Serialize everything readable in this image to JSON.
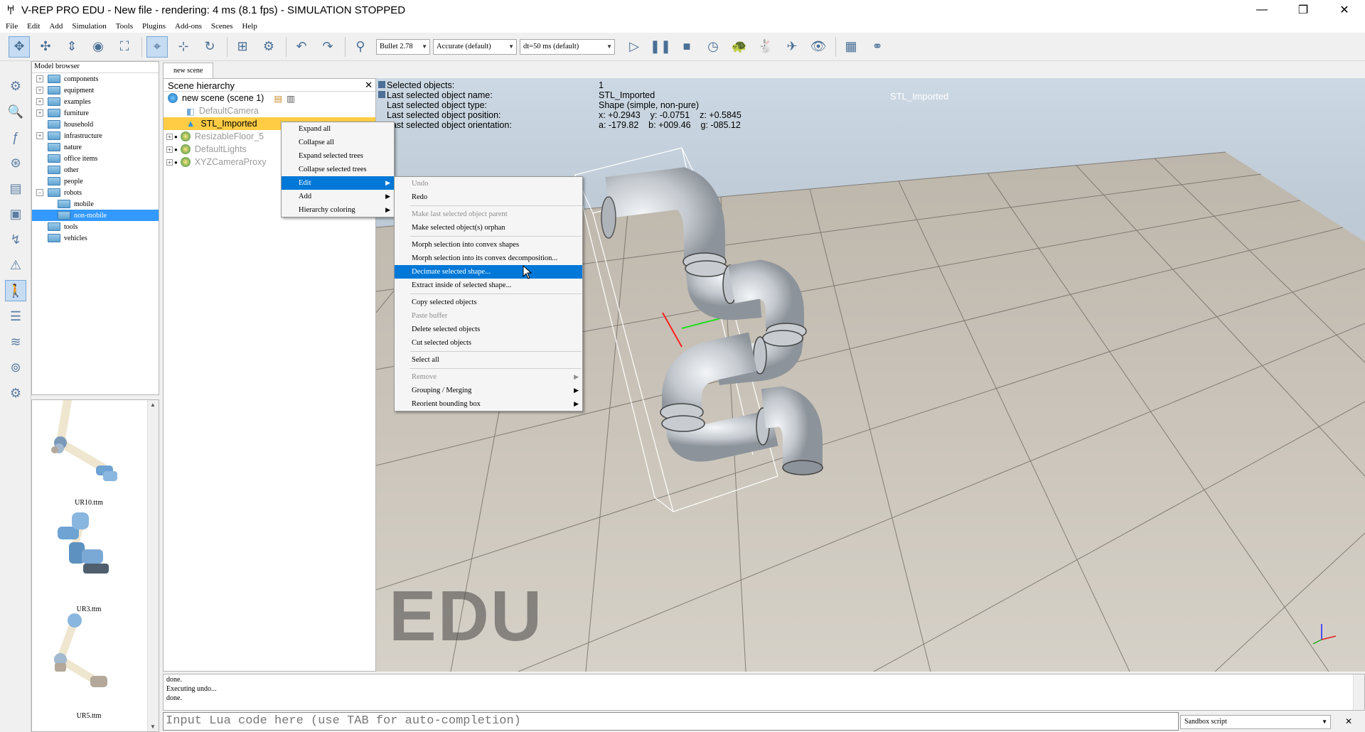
{
  "window": {
    "title": "V-REP PRO EDU - New file - rendering: 4 ms (8.1 fps) - SIMULATION STOPPED",
    "minimize": "—",
    "restore": "❐",
    "close": "✕"
  },
  "menubar": [
    "File",
    "Edit",
    "Add",
    "Simulation",
    "Tools",
    "Plugins",
    "Add-ons",
    "Scenes",
    "Help"
  ],
  "toolbar": {
    "engine": "Bullet 2.78",
    "accuracy": "Accurate (default)",
    "timestep": "dt=50 ms (default)"
  },
  "model_browser": {
    "title": "Model browser",
    "items": [
      {
        "label": "components",
        "expandable": true,
        "level": 0
      },
      {
        "label": "equipment",
        "expandable": true,
        "level": 0
      },
      {
        "label": "examples",
        "expandable": true,
        "level": 0
      },
      {
        "label": "furniture",
        "expandable": true,
        "level": 0
      },
      {
        "label": "household",
        "expandable": false,
        "level": 0
      },
      {
        "label": "infrastructure",
        "expandable": true,
        "level": 0
      },
      {
        "label": "nature",
        "expandable": false,
        "level": 0
      },
      {
        "label": "office items",
        "expandable": false,
        "level": 0
      },
      {
        "label": "other",
        "expandable": false,
        "level": 0
      },
      {
        "label": "people",
        "expandable": false,
        "level": 0
      },
      {
        "label": "robots",
        "expandable": true,
        "level": 0,
        "expanded": true
      },
      {
        "label": "mobile",
        "expandable": false,
        "level": 1
      },
      {
        "label": "non-mobile",
        "expandable": false,
        "level": 1,
        "selected": true
      },
      {
        "label": "tools",
        "expandable": false,
        "level": 0
      },
      {
        "label": "vehicles",
        "expandable": false,
        "level": 0
      }
    ],
    "thumbnails": [
      "UR10.ttm",
      "UR3.ttm",
      "UR5.ttm"
    ]
  },
  "scene_tab": "new scene",
  "hierarchy": {
    "title": "Scene hierarchy",
    "root": "new scene (scene 1)",
    "items": [
      {
        "label": "DefaultCamera"
      },
      {
        "label": "STL_Imported"
      },
      {
        "label": "ResizableFloor_5"
      },
      {
        "label": "DefaultLights"
      },
      {
        "label": "XYZCameraProxy"
      }
    ]
  },
  "info": {
    "labels": [
      "Selected objects:",
      "Last selected object name:",
      "Last selected object type:",
      "Last selected object position:",
      "Last selected object orientation:"
    ],
    "values": [
      "1",
      "STL_Imported",
      "Shape (simple, non-pure)",
      "x: +0.2943    y: -0.0751    z: +0.5845",
      "a: -179.82    b: +009.46    g: -085.12"
    ]
  },
  "viewport": {
    "object_label": "STL_Imported",
    "watermark": "EDU"
  },
  "context_menu": {
    "items": [
      "Expand all",
      "Collapse all",
      "Expand selected trees",
      "Collapse selected trees",
      "Edit",
      "Add",
      "Hierarchy coloring"
    ]
  },
  "edit_submenu": {
    "items": [
      "Undo",
      "Redo",
      "Make last selected object parent",
      "Make selected object(s) orphan",
      "Morph selection into convex shapes",
      "Morph selection into its convex decomposition...",
      "Decimate selected shape...",
      "Extract inside of selected shape...",
      "Copy selected objects",
      "Paste buffer",
      "Delete selected objects",
      "Cut selected objects",
      "Select all",
      "Remove",
      "Grouping / Merging",
      "Reorient bounding box"
    ]
  },
  "console": {
    "lines": [
      "done.",
      "Executing undo...",
      "done."
    ],
    "input_placeholder": "Input Lua code here (use TAB for auto-completion)",
    "script_type": "Sandbox script"
  }
}
